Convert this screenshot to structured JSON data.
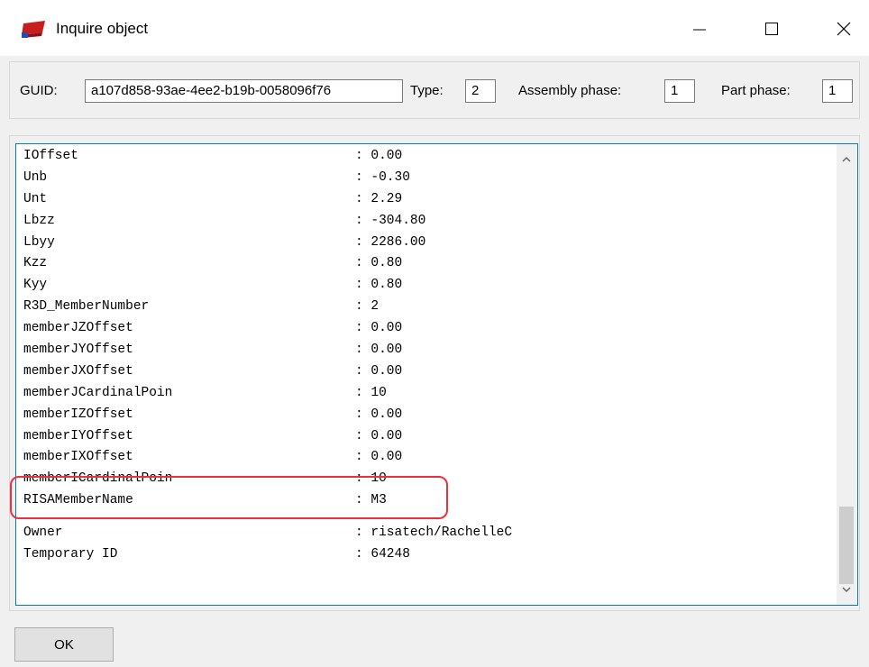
{
  "window": {
    "title": "Inquire object"
  },
  "guid_bar": {
    "guid_label": "GUID:",
    "guid_value": "a107d858-93ae-4ee2-b19b-0058096f76",
    "type_label": "Type:",
    "type_value": "2",
    "assembly_phase_label": "Assembly phase:",
    "assembly_phase_value": "1",
    "part_phase_label": "Part phase:",
    "part_phase_value": "1"
  },
  "properties": [
    {
      "key": "IOffset",
      "value": ": 0.00"
    },
    {
      "key": "Unb",
      "value": ": -0.30"
    },
    {
      "key": "Unt",
      "value": ": 2.29"
    },
    {
      "key": "Lbzz",
      "value": ": -304.80"
    },
    {
      "key": "Lbyy",
      "value": ": 2286.00"
    },
    {
      "key": "Kzz",
      "value": ": 0.80"
    },
    {
      "key": "Kyy",
      "value": ": 0.80"
    },
    {
      "key": "R3D_MemberNumber",
      "value": ": 2"
    },
    {
      "key": "memberJZOffset",
      "value": ": 0.00"
    },
    {
      "key": "memberJYOffset",
      "value": ": 0.00"
    },
    {
      "key": "memberJXOffset",
      "value": ": 0.00"
    },
    {
      "key": "memberJCardinalPoin",
      "value": ": 10"
    },
    {
      "key": "memberIZOffset",
      "value": ": 0.00"
    },
    {
      "key": "memberIYOffset",
      "value": ": 0.00"
    },
    {
      "key": "memberIXOffset",
      "value": ": 0.00"
    },
    {
      "key": "memberICardinalPoin",
      "value": ": 10"
    },
    {
      "key": "RISAMemberName",
      "value": ": M3"
    }
  ],
  "owner_info": [
    {
      "key": "Owner",
      "value": ": risatech/RachelleC"
    },
    {
      "key": "Temporary ID",
      "value": ": 64248"
    }
  ],
  "buttons": {
    "ok": "OK"
  },
  "icons": {
    "app": "tekla-app-icon",
    "minimize": "minimize-icon",
    "maximize": "maximize-icon",
    "close": "close-icon",
    "scroll_up": "chevron-up-icon",
    "scroll_down": "chevron-down-icon"
  },
  "colors": {
    "highlight": "#e8323c",
    "selection_border": "#0078d7",
    "app_icon": "#c81e1e"
  }
}
